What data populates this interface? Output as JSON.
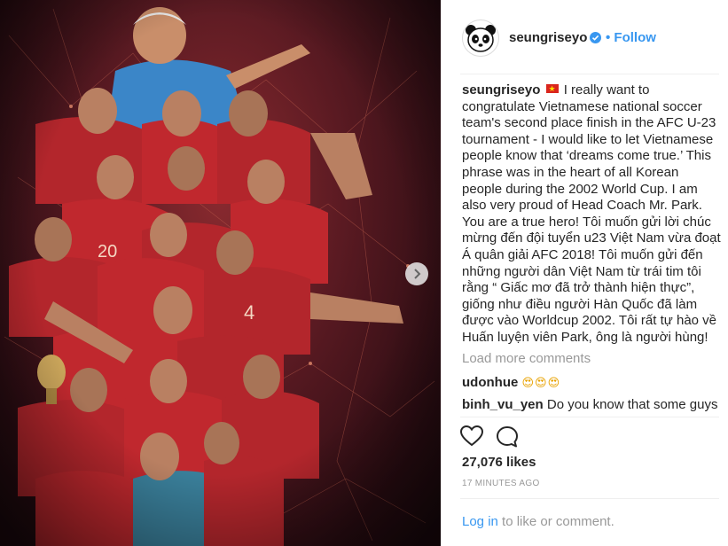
{
  "post": {
    "author": "seungriseyo",
    "follow_label": "Follow",
    "caption": "I really want to congratulate Vietnamese national soccer team's second place finish in the AFC U-23 tournament - I would like to let Vietnamese people know that ‘dreams come true.’ This phrase was in the heart of all Korean people during the 2002 World Cup. I am also very proud of Head Coach Mr. Park. You are a true hero! Tôi muốn gửi lời chúc mừng đến đội tuyển u23 Việt Nam vừa đoạt Á quân giải AFC 2018! Tôi muốn gửi đến những người dân Việt Nam từ trái tim tôi rằng “ Giấc mơ đã trở thành hiện thực”, giống như điều người Hàn Quốc đã làm được vào Worldcup 2002. Tôi rất tự hào về Huấn luyện viên Park, ông là người hùng!",
    "load_more": "Load more comments",
    "comments": [
      {
        "user": "udonhue",
        "text": "😍😍😍"
      },
      {
        "user": "binh_vu_yen",
        "text": "Do you know that some guys"
      }
    ],
    "likes": "27,076 likes",
    "time": "17 MINUTES AGO",
    "login_link": "Log in",
    "login_rest": " to like or comment."
  },
  "icons": {
    "verified": "verified-badge-icon",
    "like": "heart-icon",
    "comment": "comment-bubble-icon",
    "next": "chevron-right-icon",
    "flag": "vietnam-flag-icon",
    "avatar": "panda-avatar"
  },
  "colors": {
    "accent": "#3897f0",
    "muted": "#999999",
    "image_bg": "#5a1a22"
  }
}
